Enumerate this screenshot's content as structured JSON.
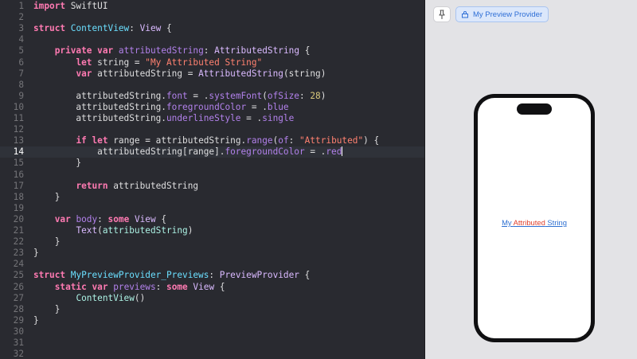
{
  "editor": {
    "current_line": 14,
    "lines": [
      [
        {
          "t": "kw",
          "v": "import"
        },
        {
          "t": "p",
          "v": " SwiftUI"
        }
      ],
      [],
      [
        {
          "t": "kw",
          "v": "struct"
        },
        {
          "t": "p",
          "v": " "
        },
        {
          "t": "dc",
          "v": "ContentView"
        },
        {
          "t": "p",
          "v": ": "
        },
        {
          "t": "ty",
          "v": "View"
        },
        {
          "t": "p",
          "v": " {"
        }
      ],
      [],
      [
        {
          "t": "p",
          "v": "    "
        },
        {
          "t": "kw",
          "v": "private"
        },
        {
          "t": "p",
          "v": " "
        },
        {
          "t": "kw",
          "v": "var"
        },
        {
          "t": "p",
          "v": " "
        },
        {
          "t": "fn",
          "v": "attributedString"
        },
        {
          "t": "p",
          "v": ": "
        },
        {
          "t": "ty",
          "v": "AttributedString"
        },
        {
          "t": "p",
          "v": " {"
        }
      ],
      [
        {
          "t": "p",
          "v": "        "
        },
        {
          "t": "kw",
          "v": "let"
        },
        {
          "t": "p",
          "v": " string = "
        },
        {
          "t": "str",
          "v": "\"My Attributed String\""
        }
      ],
      [
        {
          "t": "p",
          "v": "        "
        },
        {
          "t": "kw",
          "v": "var"
        },
        {
          "t": "p",
          "v": " attributedString = "
        },
        {
          "t": "ty",
          "v": "AttributedString"
        },
        {
          "t": "p",
          "v": "(string)"
        }
      ],
      [],
      [
        {
          "t": "p",
          "v": "        attributedString."
        },
        {
          "t": "fn",
          "v": "font"
        },
        {
          "t": "p",
          "v": " = ."
        },
        {
          "t": "fn",
          "v": "systemFont"
        },
        {
          "t": "p",
          "v": "("
        },
        {
          "t": "fn",
          "v": "ofSize"
        },
        {
          "t": "p",
          "v": ": "
        },
        {
          "t": "num",
          "v": "28"
        },
        {
          "t": "p",
          "v": ")"
        }
      ],
      [
        {
          "t": "p",
          "v": "        attributedString."
        },
        {
          "t": "fn",
          "v": "foregroundColor"
        },
        {
          "t": "p",
          "v": " = ."
        },
        {
          "t": "fn",
          "v": "blue"
        }
      ],
      [
        {
          "t": "p",
          "v": "        attributedString."
        },
        {
          "t": "fn",
          "v": "underlineStyle"
        },
        {
          "t": "p",
          "v": " = ."
        },
        {
          "t": "fn",
          "v": "single"
        }
      ],
      [],
      [
        {
          "t": "p",
          "v": "        "
        },
        {
          "t": "kw",
          "v": "if"
        },
        {
          "t": "p",
          "v": " "
        },
        {
          "t": "kw",
          "v": "let"
        },
        {
          "t": "p",
          "v": " range = attributedString."
        },
        {
          "t": "fn",
          "v": "range"
        },
        {
          "t": "p",
          "v": "("
        },
        {
          "t": "fn",
          "v": "of"
        },
        {
          "t": "p",
          "v": ": "
        },
        {
          "t": "str",
          "v": "\"Attributed\""
        },
        {
          "t": "p",
          "v": ") {"
        }
      ],
      [
        {
          "t": "p",
          "v": "            attributedString[range]."
        },
        {
          "t": "fn",
          "v": "foregroundColor"
        },
        {
          "t": "p",
          "v": " = ."
        },
        {
          "t": "fn",
          "v": "red"
        },
        {
          "t": "cur",
          "v": ""
        }
      ],
      [
        {
          "t": "p",
          "v": "        }"
        }
      ],
      [],
      [
        {
          "t": "p",
          "v": "        "
        },
        {
          "t": "kw",
          "v": "return"
        },
        {
          "t": "p",
          "v": " attributedString"
        }
      ],
      [
        {
          "t": "p",
          "v": "    }"
        }
      ],
      [],
      [
        {
          "t": "p",
          "v": "    "
        },
        {
          "t": "kw",
          "v": "var"
        },
        {
          "t": "p",
          "v": " "
        },
        {
          "t": "fn",
          "v": "body"
        },
        {
          "t": "p",
          "v": ": "
        },
        {
          "t": "kw",
          "v": "some"
        },
        {
          "t": "p",
          "v": " "
        },
        {
          "t": "ty",
          "v": "View"
        },
        {
          "t": "p",
          "v": " {"
        }
      ],
      [
        {
          "t": "p",
          "v": "        "
        },
        {
          "t": "ty",
          "v": "Text"
        },
        {
          "t": "p",
          "v": "("
        },
        {
          "t": "ty2",
          "v": "attributedString"
        },
        {
          "t": "p",
          "v": ")"
        }
      ],
      [
        {
          "t": "p",
          "v": "    }"
        }
      ],
      [
        {
          "t": "p",
          "v": "}"
        }
      ],
      [],
      [
        {
          "t": "kw",
          "v": "struct"
        },
        {
          "t": "p",
          "v": " "
        },
        {
          "t": "dc",
          "v": "MyPreviewProvider_Previews"
        },
        {
          "t": "p",
          "v": ": "
        },
        {
          "t": "ty",
          "v": "PreviewProvider"
        },
        {
          "t": "p",
          "v": " {"
        }
      ],
      [
        {
          "t": "p",
          "v": "    "
        },
        {
          "t": "kw",
          "v": "static"
        },
        {
          "t": "p",
          "v": " "
        },
        {
          "t": "kw",
          "v": "var"
        },
        {
          "t": "p",
          "v": " "
        },
        {
          "t": "fn",
          "v": "previews"
        },
        {
          "t": "p",
          "v": ": "
        },
        {
          "t": "kw",
          "v": "some"
        },
        {
          "t": "p",
          "v": " "
        },
        {
          "t": "ty",
          "v": "View"
        },
        {
          "t": "p",
          "v": " {"
        }
      ],
      [
        {
          "t": "p",
          "v": "        "
        },
        {
          "t": "ty2",
          "v": "ContentView"
        },
        {
          "t": "p",
          "v": "()"
        }
      ],
      [
        {
          "t": "p",
          "v": "    }"
        }
      ],
      [
        {
          "t": "p",
          "v": "}"
        }
      ],
      [],
      [],
      []
    ]
  },
  "canvas": {
    "pin_icon": "pin-icon",
    "chip_icon": "device-icon",
    "preview_label": "My Preview Provider",
    "preview_text_before": "My ",
    "preview_text_highlight": "Attributed",
    "preview_text_after": " String",
    "text_blue": "#2d6fd1",
    "text_red": "#e0412e"
  }
}
